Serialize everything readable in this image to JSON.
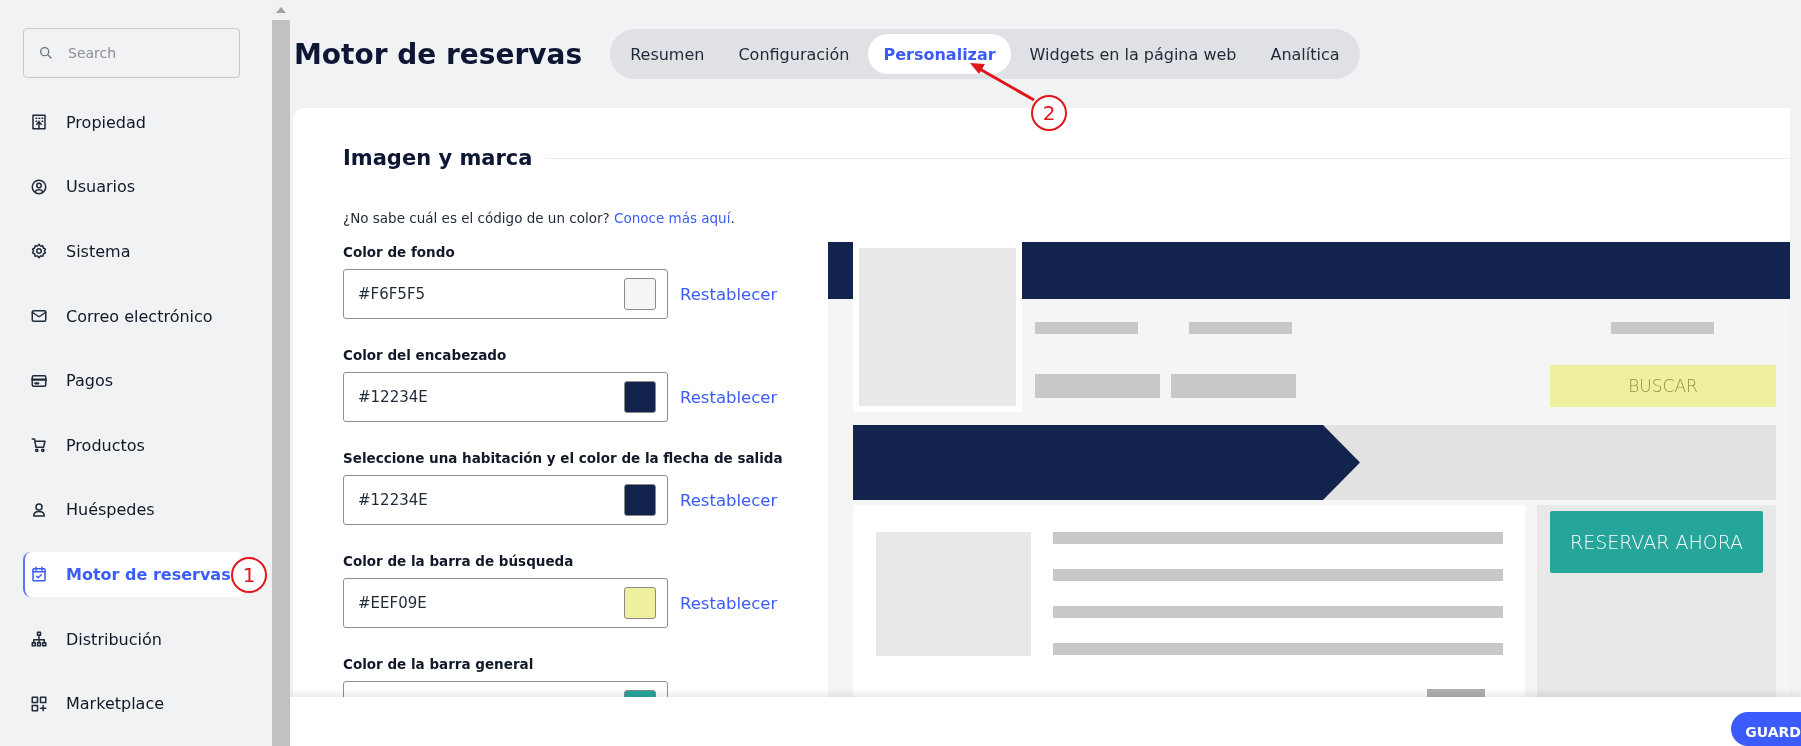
{
  "sidebar": {
    "search": {
      "placeholder": "Search"
    },
    "items": [
      {
        "label": "Propiedad",
        "selected": false
      },
      {
        "label": "Usuarios",
        "selected": false
      },
      {
        "label": "Sistema",
        "selected": false
      },
      {
        "label": "Correo electrónico",
        "selected": false
      },
      {
        "label": "Pagos",
        "selected": false
      },
      {
        "label": "Productos",
        "selected": false
      },
      {
        "label": "Huéspedes",
        "selected": false
      },
      {
        "label": "Motor de reservas",
        "selected": true
      },
      {
        "label": "Distribución",
        "selected": false
      },
      {
        "label": "Marketplace",
        "selected": false
      }
    ]
  },
  "header": {
    "title": "Motor de reservas",
    "tabs": [
      {
        "label": "Resumen",
        "selected": false
      },
      {
        "label": "Configuración",
        "selected": false
      },
      {
        "label": "Personalizar",
        "selected": true
      },
      {
        "label": "Widgets en la página web",
        "selected": false
      },
      {
        "label": "Analítica",
        "selected": false
      }
    ]
  },
  "section": {
    "title": "Imagen y marca",
    "help": {
      "text": "¿No sabe cuál es el código de un color?",
      "link": "Conoce más aquí",
      "after": "."
    }
  },
  "fields": [
    {
      "label": "Color de fondo",
      "value": "#F6F5F5",
      "color": "#f6f5f5",
      "reset": "Restablecer"
    },
    {
      "label": "Color del encabezado",
      "value": "#12234E",
      "color": "#12234e",
      "reset": "Restablecer"
    },
    {
      "label": "Seleccione una habitación y el color de la flecha de salida",
      "value": "#12234E",
      "color": "#12234e",
      "reset": "Restablecer"
    },
    {
      "label": "Color de la barra de búsqueda",
      "value": "#EEF09E",
      "color": "#eef09e",
      "reset": "Restablecer"
    },
    {
      "label": "Color de la barra general",
      "color": "#26a69a"
    }
  ],
  "preview": {
    "search_button": "BUSCAR",
    "book_button": "RESERVAR AHORA"
  },
  "footer": {
    "save_button": "GUARD"
  },
  "annotations": [
    {
      "label": "1"
    },
    {
      "label": "2"
    }
  ]
}
